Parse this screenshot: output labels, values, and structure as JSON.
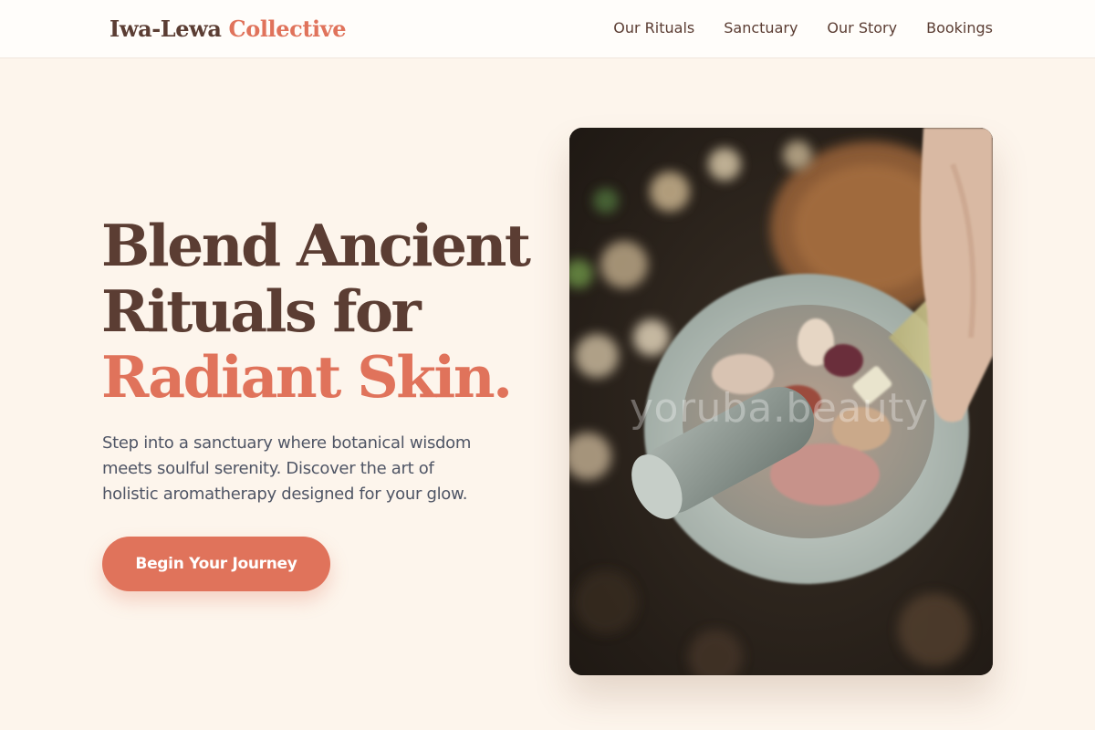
{
  "header": {
    "logo_main": "Iwa-Lewa",
    "logo_accent": "Collective",
    "nav": [
      {
        "label": "Our Rituals"
      },
      {
        "label": "Sanctuary"
      },
      {
        "label": "Our Story"
      },
      {
        "label": "Bookings"
      }
    ]
  },
  "hero": {
    "title_line_1": "Blend Ancient",
    "title_line_2": "Rituals for",
    "title_accent": "Radiant Skin.",
    "subtitle_line_1": "Step into a sanctuary where botanical wisdom",
    "subtitle_line_2": "meets soulful serenity. Discover the art of",
    "subtitle_line_3": "holistic aromatherapy designed for your glow.",
    "cta_label": "Begin Your Journey",
    "image_watermark": "yoruba.beauty"
  },
  "colors": {
    "background": "#fdf5ec",
    "primary_text": "#5b3d33",
    "accent": "#e0735b",
    "body_text": "#4f5565"
  }
}
